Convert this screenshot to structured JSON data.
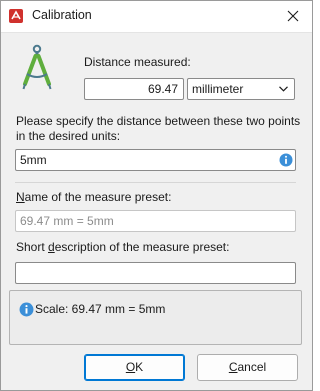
{
  "window": {
    "title": "Calibration",
    "icon": "pdf-app-icon",
    "close_icon": "close-icon"
  },
  "distance": {
    "label": "Distance measured:",
    "value": "69.47",
    "unit": "millimeter"
  },
  "specify": {
    "label": "Please specify the distance between these two points in the desired units:",
    "value": "5mm"
  },
  "preset_name": {
    "label_prefix": "N",
    "label_rest": "ame of the measure preset:",
    "placeholder": "69.47 mm = 5mm"
  },
  "preset_description": {
    "label_prefix": "Short ",
    "label_access": "d",
    "label_rest": "escription of the measure preset:",
    "value": ""
  },
  "status": {
    "text": "Scale: 69.47 mm = 5mm"
  },
  "buttons": {
    "ok_access": "O",
    "ok_rest": "K",
    "cancel_access": "C",
    "cancel_rest": "ancel"
  },
  "colors": {
    "accent": "#0078d4",
    "info": "#3b8fd8",
    "compass": "#5fae3d"
  }
}
